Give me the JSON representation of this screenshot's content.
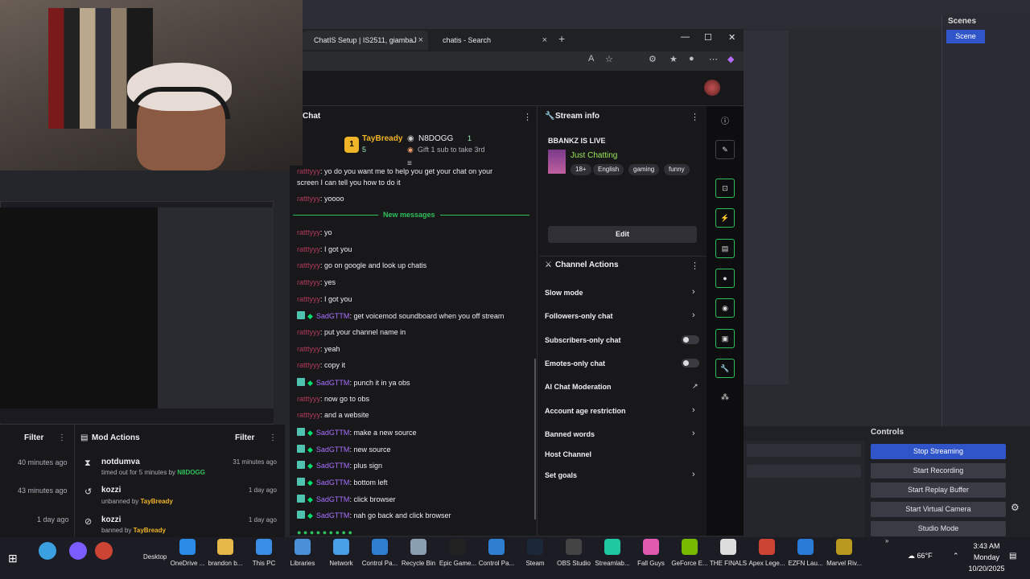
{
  "browser": {
    "tabs": [
      {
        "label": "ChatIS Setup | IS2511, giambaJ",
        "close": "×"
      },
      {
        "label": "chatis - Search",
        "close": "×"
      }
    ],
    "new_tab": "+"
  },
  "chat": {
    "title": "Chat",
    "leaderboard": {
      "first": {
        "rank": "1",
        "name": "TayBready",
        "score": "5"
      },
      "second": {
        "name": "N8DOGG",
        "score": "1"
      },
      "gift_text": "Gift 1 sub to take 3rd"
    },
    "new_messages_label": "New messages",
    "messages_before": [
      {
        "user": "ratttyyy",
        "text": ": yo do you want me to help you get your chat on your"
      },
      {
        "user": "",
        "text": "screen I can tell you how to do it"
      },
      {
        "user": "ratttyyy",
        "text": ": yoooo"
      }
    ],
    "messages": [
      {
        "user": "ratttyyy",
        "text": ": yo",
        "badges": false
      },
      {
        "user": "ratttyyy",
        "text": ": I got you",
        "badges": false
      },
      {
        "user": "ratttyyy",
        "text": ": go on google and look up chatis",
        "badges": false
      },
      {
        "user": "ratttyyy",
        "text": ": yes",
        "badges": false
      },
      {
        "user": "ratttyyy",
        "text": ": I got you",
        "badges": false
      },
      {
        "user": "SadGTTM",
        "text": ": get voicemod soundboard when you off stream",
        "badges": true
      },
      {
        "user": "ratttyyy",
        "text": ": put your channel name in",
        "badges": false
      },
      {
        "user": "ratttyyy",
        "text": ": yeah",
        "badges": false
      },
      {
        "user": "ratttyyy",
        "text": ": copy it",
        "badges": false
      },
      {
        "user": "SadGTTM",
        "text": ": punch it in ya obs",
        "badges": true
      },
      {
        "user": "ratttyyy",
        "text": ": now go to obs",
        "badges": false
      },
      {
        "user": "ratttyyy",
        "text": ": and a website",
        "badges": false
      },
      {
        "user": "SadGTTM",
        "text": ": make a new source",
        "badges": true
      },
      {
        "user": "SadGTTM",
        "text": ": new source",
        "badges": true
      },
      {
        "user": "SadGTTM",
        "text": ": plus sign",
        "badges": true
      },
      {
        "user": "SadGTTM",
        "text": ": bottom left",
        "badges": true
      },
      {
        "user": "SadGTTM",
        "text": ": click browser",
        "badges": true
      },
      {
        "user": "SadGTTM",
        "text": ": nah go back and click browser",
        "badges": true
      }
    ]
  },
  "stream_info": {
    "title": "Stream info",
    "stream_title": "BBANKZ IS LIVE",
    "category": "Just Chatting",
    "tags": [
      "18+",
      "English",
      "gaming",
      "funny"
    ],
    "edit_label": "Edit"
  },
  "channel_actions": {
    "title": "Channel Actions",
    "items": [
      {
        "label": "Slow mode",
        "control": "chevron"
      },
      {
        "label": "Followers-only chat",
        "control": "chevron"
      },
      {
        "label": "Subscribers-only chat",
        "control": "toggle"
      },
      {
        "label": "Emotes-only chat",
        "control": "toggle"
      },
      {
        "label": "AI Chat Moderation",
        "control": "external"
      },
      {
        "label": "Account age restriction",
        "control": "chevron"
      },
      {
        "label": "Banned words",
        "control": "chevron"
      },
      {
        "label": "Host Channel",
        "control": "none"
      },
      {
        "label": "Set goals",
        "control": "chevron"
      }
    ]
  },
  "left_feed": {
    "filter_label": "Filter",
    "times": [
      "40 minutes ago",
      "43 minutes ago",
      "1 day ago"
    ]
  },
  "mod_actions": {
    "title": "Mod Actions",
    "filter_label": "Filter",
    "items": [
      {
        "user": "notdumva",
        "desc": "timed out for 5 minutes by",
        "by": "N8DOGG",
        "time": "31 minutes ago"
      },
      {
        "user": "kozzi",
        "desc": "unbanned by",
        "by": "TayBready",
        "time": "1 day ago"
      },
      {
        "user": "kozzi",
        "desc": "banned by",
        "by": "TayBready",
        "time": "1 day ago"
      }
    ]
  },
  "obs": {
    "scenes_title": "Scenes",
    "scene_item": "Scene",
    "controls_title": "Controls",
    "controls": [
      "Stop Streaming",
      "Start Recording",
      "Start Replay Buffer",
      "Start Virtual Camera",
      "Studio Mode"
    ]
  },
  "taskbar": {
    "desktop_label": "Desktop",
    "apps": [
      "OneDrive ...",
      "brandon b...",
      "This PC",
      "Libraries",
      "Network",
      "Control Pa...",
      "Recycle Bin",
      "Epic Game...",
      "Control Pa...",
      "Steam",
      "OBS Studio",
      "Streamlab...",
      "Fall Guys",
      "GeForce E...",
      "THE FINALS",
      "Apex Lege...",
      "EZFN Lau...",
      "Marvel Riv..."
    ],
    "weather": "66°F",
    "time": "3:43 AM",
    "day": "Monday",
    "date": "10/20/2025"
  },
  "colors": {
    "accent_green": "#2ec05b",
    "obs_blue": "#3055c9",
    "twitch_bg": "#18181b"
  }
}
